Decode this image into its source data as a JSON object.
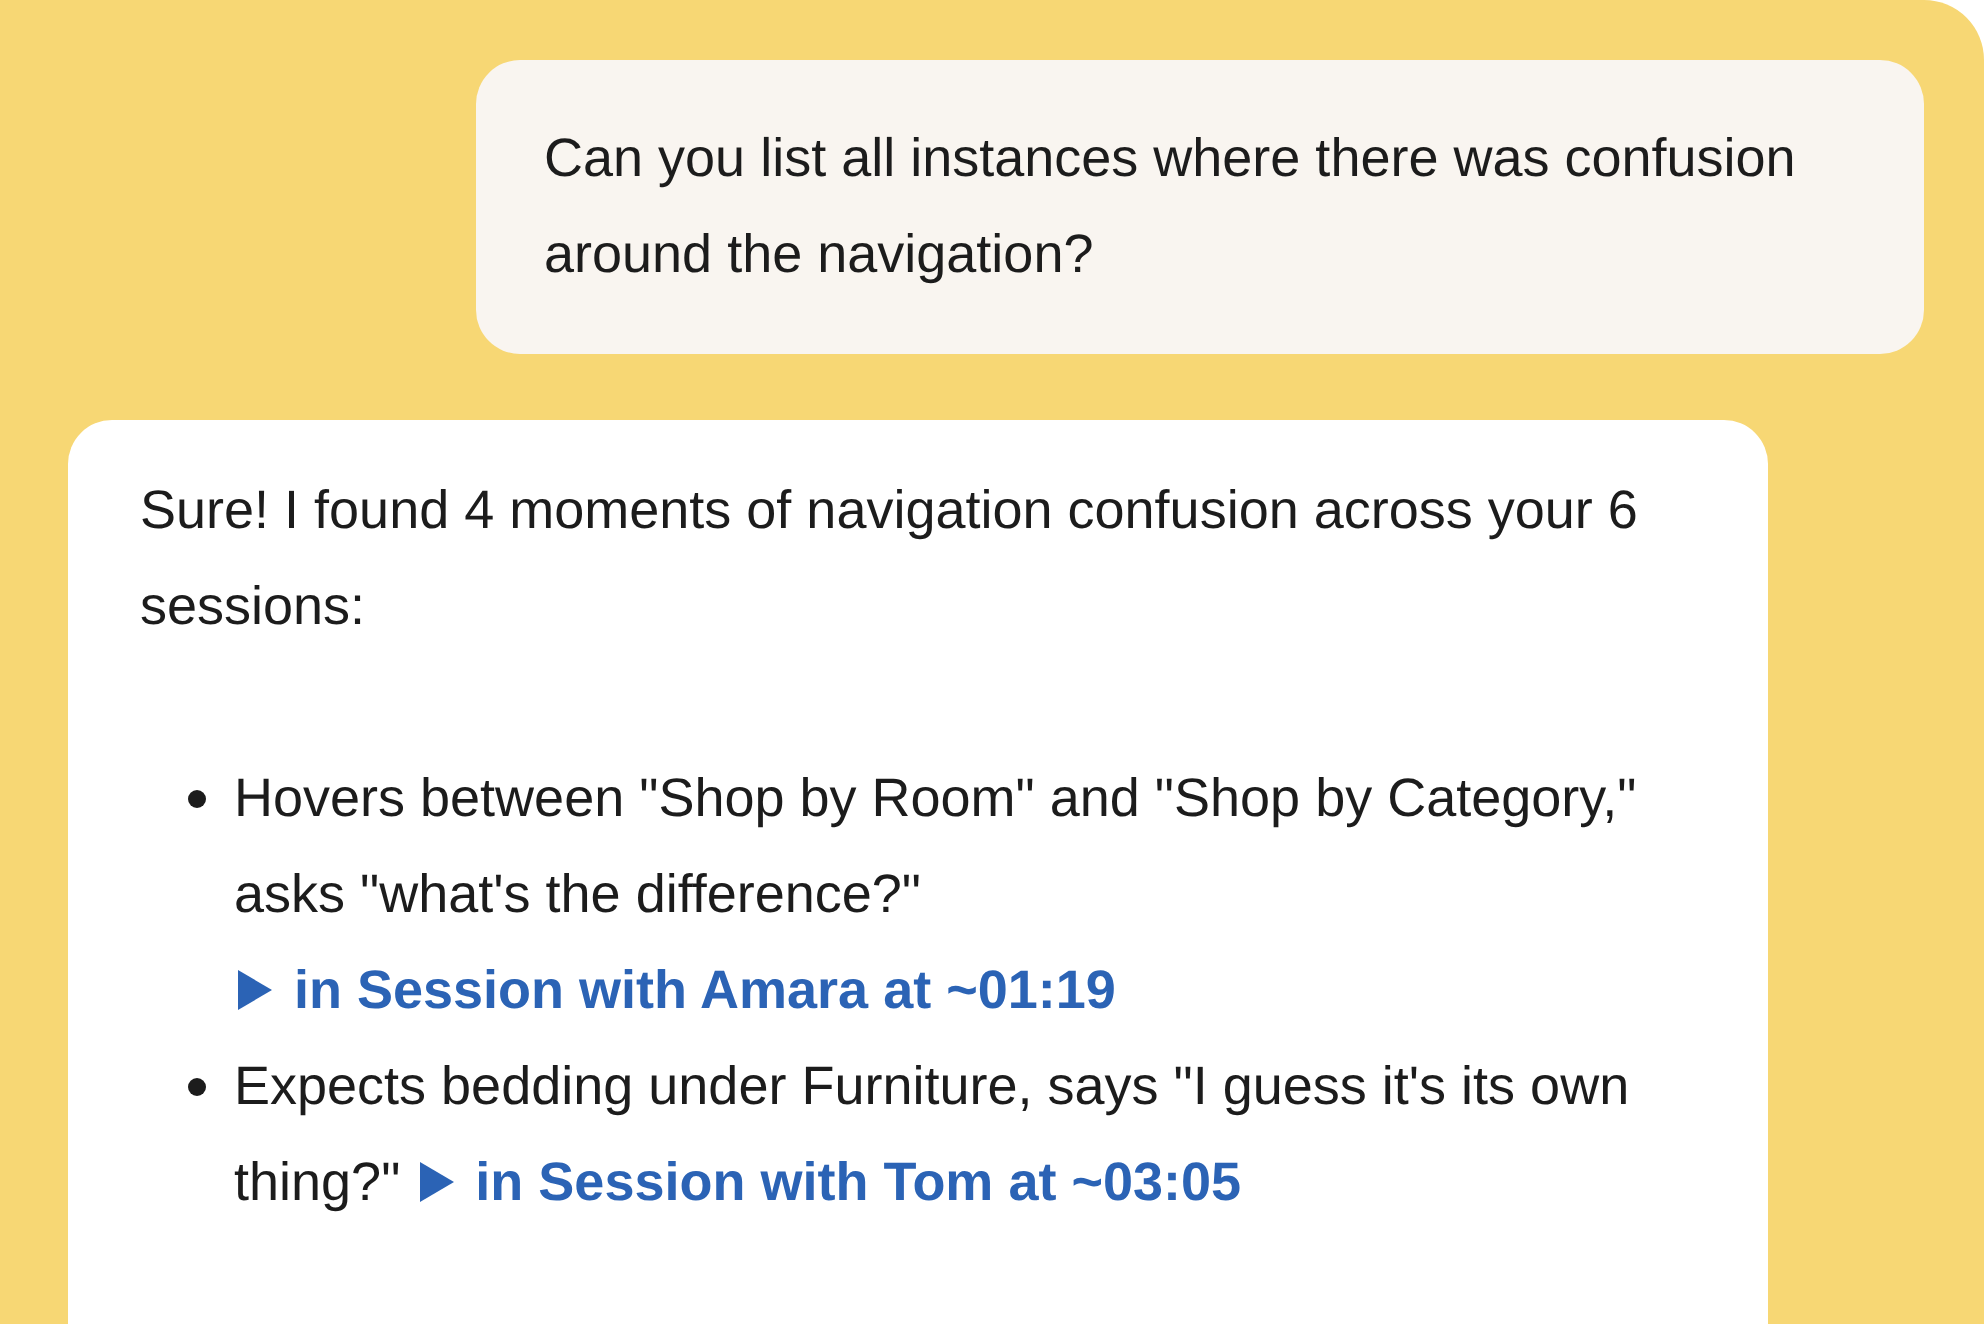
{
  "user_message": {
    "text": "Can you list all instances where there was confusion around the navigation?"
  },
  "assistant_message": {
    "intro": "Sure! I found 4 moments of navigation confusion across your 6 sessions:",
    "items": [
      {
        "text": "Hovers between \"Shop by Room\" and \"Shop by Category,\" asks \"what's the difference?\"",
        "link": "in Session with Amara at ~01:19"
      },
      {
        "text": "Expects bedding under Furniture, says \"I guess it's its own thing?\"",
        "link": "in Session with Tom at ~03:05"
      }
    ]
  }
}
